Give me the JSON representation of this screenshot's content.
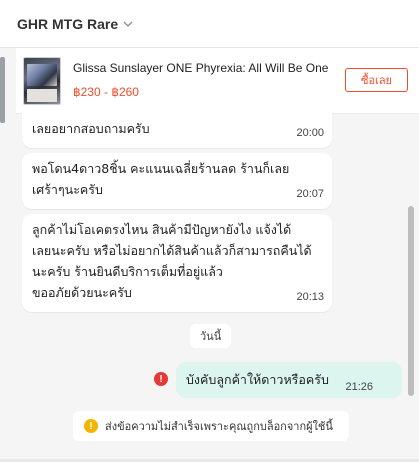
{
  "header": {
    "shop_name": "GHR MTG Rare",
    "dropdown_icon": "chevron-down-icon"
  },
  "product": {
    "name": "Glissa Sunslayer ONE Phyrexia: All Will Be One",
    "price": "฿230 - ฿260",
    "buy_label": "ซื้อเลย",
    "accent": "#ee4d2d"
  },
  "messages": [
    {
      "text": "เลยอยากสอบถามครับ",
      "time": "20:00"
    },
    {
      "text_lines": [
        "พอโดน4ดาว8ชิ้น คะแนนเฉลี่ยร้านลด ร้านก็เลย",
        "เศร้าๆนะครับ"
      ],
      "time": "20:07"
    },
    {
      "text_lines": [
        "ลูกค้าไม่โอเคตรงไหน สินค้ามีปัญหายังไง แจ้งได้",
        "เลยนะครับ หรือไม่อยากได้สินค้าแล้วก็สามารถคืนได้",
        "นะครับ ร้านยินดีบริการเต็มที่อยู่แล้ว",
        "ขออภัยด้วยนะครับ"
      ],
      "time": "20:13"
    }
  ],
  "day_separator": "วันนี้",
  "my_message": {
    "text": "บังคับลูกค้าให้ดาวหรือครับ",
    "time": "21:26",
    "status_icon": "error-icon"
  },
  "notice": {
    "text": "ส่งข้อความไม่สำเร็จเพราะคุณถูกบล็อกจากผู้ใช้นี้",
    "icon": "warning-icon"
  },
  "colors": {
    "error": "#e53935",
    "warning": "#f5b400",
    "my_bubble": "#dcf5ee"
  }
}
